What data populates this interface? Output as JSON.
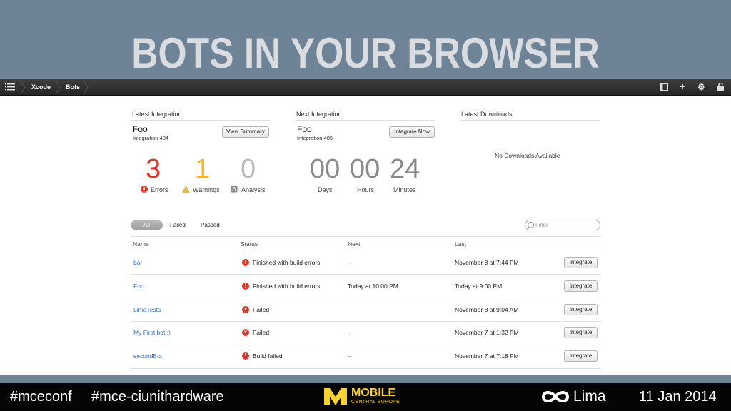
{
  "slide": {
    "title": "BOTS IN YOUR BROWSER"
  },
  "toolbar": {
    "xcode": "Xcode",
    "bots": "Bots",
    "plus": "+",
    "gear": "⚙"
  },
  "latest_integration": {
    "title": "Latest Integration",
    "name": "Foo",
    "integration": "Integration 484",
    "button": "View Summary",
    "errors": {
      "count": "3",
      "label": "Errors"
    },
    "warnings": {
      "count": "1",
      "label": "Warnings"
    },
    "analysis": {
      "count": "0",
      "label": "Analysis"
    }
  },
  "next_integration": {
    "title": "Next Integration",
    "name": "Foo",
    "integration": "Integration 485",
    "button": "Integrate Now",
    "days": {
      "value": "00",
      "label": "Days"
    },
    "hours": {
      "value": "00",
      "label": "Hours"
    },
    "minutes": {
      "value": "24",
      "label": "Minutes"
    }
  },
  "downloads": {
    "title": "Latest Downloads",
    "empty": "No Downloads Available"
  },
  "filters": {
    "all": "All",
    "failed": "Failed",
    "passed": "Passed",
    "search_placeholder": "Filter"
  },
  "table": {
    "headers": {
      "name": "Name",
      "status": "Status",
      "next": "Next",
      "last": "Last"
    },
    "rows": [
      {
        "name": "bar",
        "status": "Finished with build errors",
        "status_icon": "!",
        "next": "--",
        "last": "November 8 at 7:44 PM",
        "action": "Integrate"
      },
      {
        "name": "Foo",
        "status": "Finished with build errors",
        "status_icon": "!",
        "next": "Today at 10:00 PM",
        "last": "Today at 9:00 PM",
        "action": "Integrate"
      },
      {
        "name": "LimaTests",
        "status": "Failed",
        "status_icon": "×",
        "next": "",
        "last": "November 8 at 9:04 AM",
        "action": "Integrate"
      },
      {
        "name": "My First bot :)",
        "status": "Failed",
        "status_icon": "×",
        "next": "--",
        "last": "November 7 at 1:32 PM",
        "action": "Integrate"
      },
      {
        "name": "secondBot",
        "status": "Build failed",
        "status_icon": "!",
        "next": "--",
        "last": "November 7 at 7:18 PM",
        "action": "Integrate"
      }
    ]
  },
  "footer": {
    "hashtag1": "#mceconf",
    "hashtag2": "#mce-ciunithardware",
    "brand": "MOBILE",
    "brand_sub": "CENTRAL EUROPE",
    "sponsor": "Lima",
    "date": "11 Jan 2014"
  },
  "colors": {
    "error": "#d93a2b",
    "warning": "#f2b429",
    "link": "#3a74c8",
    "brand": "#f7d231"
  }
}
